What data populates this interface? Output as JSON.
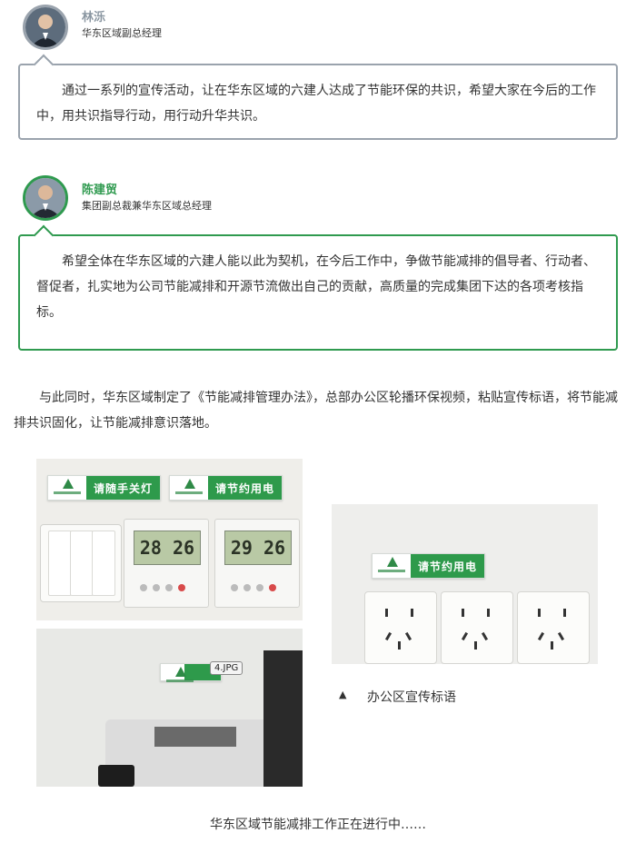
{
  "speakers": [
    {
      "name": "林泺",
      "title": "华东区域副总经理",
      "quote": "通过一系列的宣传活动，让在华东区域的六建人达成了节能环保的共识，希望大家在今后的工作中，用共识指导行动，用行动升华共识。"
    },
    {
      "name": "陈建贸",
      "title": "集团副总裁兼华东区域总经理",
      "quote": "希望全体在华东区域的六建人能以此为契机，在今后工作中，争做节能减排的倡导者、行动者、督促者，扎实地为公司节能减排和开源节流做出自己的贡献，高质量的完成集团下达的各项考核指标。"
    }
  ],
  "body_paragraph": "与此同时，华东区域制定了《节能减排管理办法》，总部办公区轮播环保视频，粘贴宣传标语，将节能减排共识固化，让节能减排意识落地。",
  "photos": {
    "sign_turn_off_light": "请随手关灯",
    "sign_save_power": "请节约用电",
    "sign_save_power_2": "请节约用电",
    "thermostat_1": "28 26",
    "thermostat_2": "29 26",
    "file_tag": "4.JPG",
    "caption_icon": "▲",
    "caption": "办公区宣传标语"
  },
  "footer": "华东区域节能减排工作正在进行中……",
  "colors": {
    "accent_green": "#2f9a4f",
    "accent_gray": "#9aa3ad"
  }
}
